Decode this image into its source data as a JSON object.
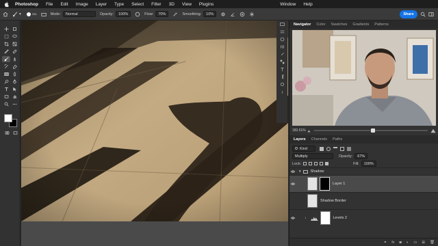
{
  "menubar": {
    "app_name": "Photoshop",
    "items": [
      "File",
      "Edit",
      "Image",
      "Layer",
      "Type",
      "Select",
      "Filter",
      "3D",
      "View",
      "Plugins",
      "Window",
      "Help"
    ]
  },
  "options_bar": {
    "brush_size": "111",
    "mode_label": "Mode:",
    "mode_value": "Normal",
    "opacity_label": "Opacity:",
    "opacity_value": "100%",
    "flow_label": "Flow:",
    "flow_value": "70%",
    "smoothing_label": "Smoothing:",
    "smoothing_value": "10%",
    "share_label": "Share"
  },
  "navigator": {
    "tabs": [
      "Navigator",
      "Color",
      "Swatches",
      "Gradients",
      "Patterns"
    ],
    "zoom": "183.51%",
    "zoom_fraction": 0.52
  },
  "layers": {
    "tabs": [
      "Layers",
      "Channels",
      "Paths"
    ],
    "filter_kind": "Kind",
    "blend_mode": "Multiply",
    "opacity_label": "Opacity:",
    "opacity_value": "67%",
    "lock_label": "Lock:",
    "fill_label": "Fill:",
    "fill_value": "100%",
    "group_name": "Shadow",
    "layer1_name": "Layer 1",
    "layer2_name": "Shadow Border",
    "layer3_name": "Levels 2"
  },
  "colors": {
    "accent": "#1473e6",
    "foreground": "#ffffff",
    "background": "#000000"
  }
}
